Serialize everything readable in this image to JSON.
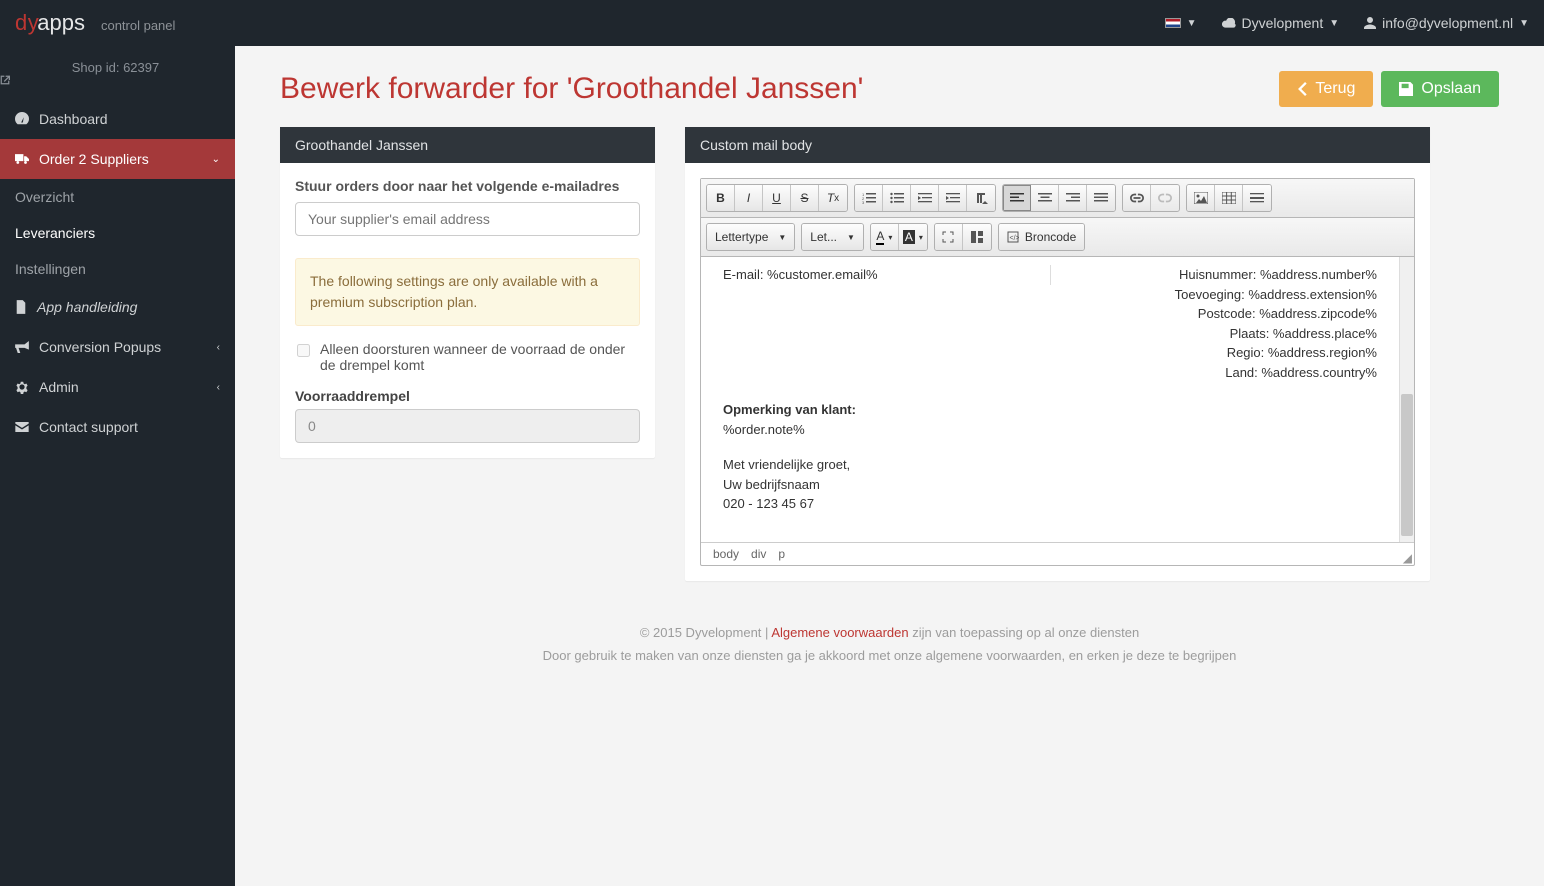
{
  "brand": {
    "prefix": "dy",
    "suffix": "apps",
    "subtitle": "control panel"
  },
  "topbar": {
    "company": "Dyvelopment",
    "email": "info@dyvelopment.nl"
  },
  "sidebar": {
    "shop_id_label": "Shop id: 62397",
    "items": [
      {
        "icon": "dashboard-icon",
        "label": "Dashboard"
      },
      {
        "icon": "truck-icon",
        "label": "Order 2 Suppliers",
        "expand": true,
        "active": true
      },
      {
        "sub": true,
        "label": "Overzicht"
      },
      {
        "sub": true,
        "label": "Leveranciers",
        "active": true
      },
      {
        "sub": true,
        "label": "Instellingen"
      },
      {
        "icon": "doc-icon",
        "label": "App handleiding",
        "italic": true
      },
      {
        "icon": "bullhorn-icon",
        "label": "Conversion Popups",
        "expand": true
      },
      {
        "icon": "cog-icon",
        "label": "Admin",
        "expand": true
      },
      {
        "icon": "mail-icon",
        "label": "Contact support"
      }
    ]
  },
  "page": {
    "title": "Bewerk forwarder for 'Groothandel Janssen'",
    "back_label": "Terug",
    "save_label": "Opslaan"
  },
  "left_panel": {
    "title": "Groothandel Janssen",
    "email_label": "Stuur orders door naar het volgende e-mailadres",
    "email_placeholder": "Your supplier's email address",
    "alert": "The following settings are only available with a premium subscription plan.",
    "check_label": "Alleen doorsturen wanneer de voorraad de onder de drempel komt",
    "threshold_label": "Voorraaddrempel",
    "threshold_value": "0"
  },
  "right_panel": {
    "title": "Custom mail body",
    "toolbar": {
      "font_family_label": "Lettertype",
      "font_size_label": "Let...",
      "source_label": "Broncode"
    },
    "content": {
      "left_col": "E-mail:  %customer.email%",
      "right_lines": [
        "Huisnummer:  %address.number%",
        "Toevoeging:  %address.extension%",
        "Postcode:  %address.zipcode%",
        "Plaats:  %address.place%",
        "Regio:  %address.region%",
        "Land:  %address.country%"
      ],
      "note_head": "Opmerking van klant:",
      "note_body": "%order.note%",
      "sig1": "Met vriendelijke groet,",
      "sig2": "Uw bedrijfsnaam",
      "sig3": "020 - 123 45 67"
    },
    "path": [
      "body",
      "div",
      "p"
    ]
  },
  "footer": {
    "line1a": "© 2015 Dyvelopment | ",
    "link": "Algemene voorwaarden",
    "line1b": " zijn van toepassing op al onze diensten",
    "line2": "Door gebruik te maken van onze diensten ga je akkoord met onze algemene voorwaarden, en erken je deze te begrijpen"
  }
}
